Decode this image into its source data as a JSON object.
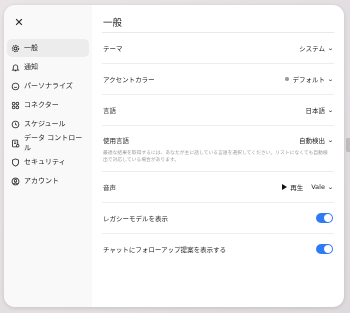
{
  "close_label": "✕",
  "sidebar": {
    "items": [
      {
        "label": "一般",
        "icon": "gear-icon"
      },
      {
        "label": "通知",
        "icon": "bell-icon"
      },
      {
        "label": "パーソナライズ",
        "icon": "personalize-icon"
      },
      {
        "label": "コネクター",
        "icon": "connector-icon"
      },
      {
        "label": "スケジュール",
        "icon": "clock-icon"
      },
      {
        "label": "データ コントロール",
        "icon": "data-control-icon"
      },
      {
        "label": "セキュリティ",
        "icon": "shield-icon"
      },
      {
        "label": "アカウント",
        "icon": "account-icon"
      }
    ],
    "active_index": 0
  },
  "main": {
    "title": "一般",
    "theme": {
      "label": "テーマ",
      "value": "システム"
    },
    "accent": {
      "label": "アクセントカラー",
      "value": "デフォルト",
      "color": "#9a9a9a"
    },
    "language": {
      "label": "言語",
      "value": "日本語"
    },
    "spoken_language": {
      "label": "使用言語",
      "value": "自動検出",
      "description": "最適な結果を取得するには、あなたが主に話している言語を選択してください。リストになくても自動検出で対応している場合があります。"
    },
    "voice": {
      "label": "音声",
      "play_label": "再生",
      "value": "Vale"
    },
    "legacy_models": {
      "label": "レガシーモデルを表示",
      "enabled": true
    },
    "followup": {
      "label": "チャットにフォローアップ提案を表示する",
      "enabled": true
    }
  },
  "colors": {
    "toggle_on": "#2f7bf6",
    "sidebar_bg": "#f9f9f9",
    "active_item_bg": "#ececec"
  }
}
